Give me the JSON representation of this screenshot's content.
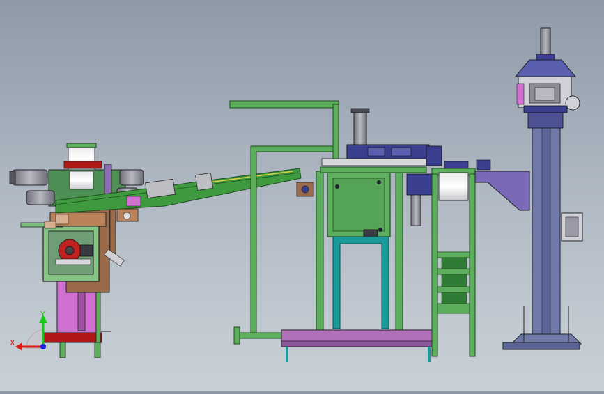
{
  "viewport": {
    "background_top": "#8f9aa8",
    "background_bottom": "#c9d0d7"
  },
  "triad": {
    "x_label": "X",
    "y_label": "Y",
    "x_color": "#e01818",
    "y_color": "#18c818",
    "z_color": "#1818e0"
  },
  "palette": {
    "frame_green": "#5cae5c",
    "dark_green": "#2f7a35",
    "conveyor_green": "#3f9a3f",
    "navy": "#3b3f8f",
    "purple": "#8a6bb0",
    "magenta": "#d070d0",
    "red": "#b01818",
    "brown": "#9a6a4a",
    "grey": "#8c8c96",
    "teal": "#1b9a9a",
    "white": "#f0f0f0"
  }
}
